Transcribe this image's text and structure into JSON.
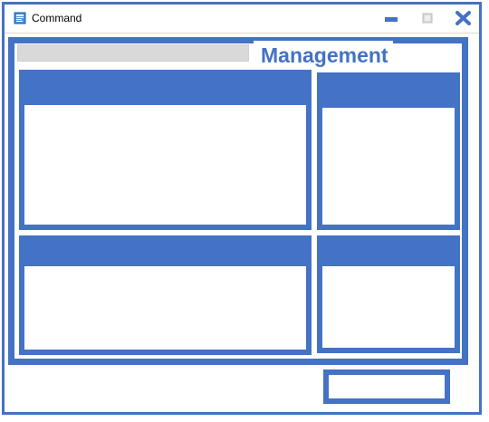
{
  "window": {
    "title": "Command",
    "icons": {
      "app": "app-window-icon",
      "minimize": "minimize-icon",
      "maximize": "maximize-icon",
      "close": "close-icon"
    }
  },
  "main": {
    "heading": "Management",
    "search_value": ""
  },
  "colors": {
    "accent": "#4472c4",
    "search_fill": "#d9d9d9",
    "background": "#ffffff",
    "text": "#000000"
  }
}
